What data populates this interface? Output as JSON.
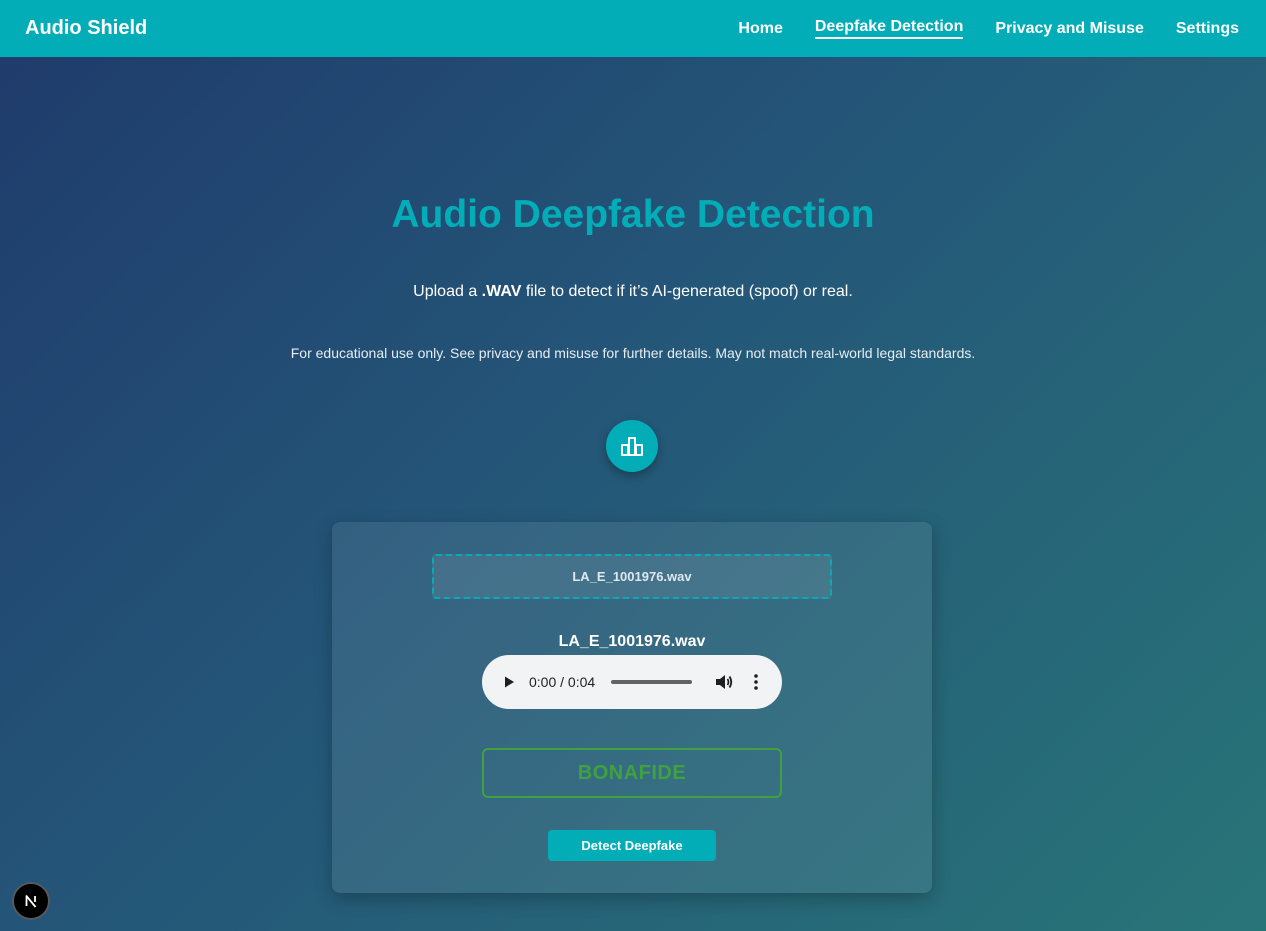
{
  "navbar": {
    "brand": "Audio Shield",
    "links": [
      {
        "label": "Home",
        "active": false
      },
      {
        "label": "Deepfake Detection",
        "active": true
      },
      {
        "label": "Privacy and Misuse",
        "active": false
      },
      {
        "label": "Settings",
        "active": false
      }
    ]
  },
  "hero": {
    "title": "Audio Deepfake Detection",
    "subtitle_before": "Upload a ",
    "subtitle_bold": ".WAV",
    "subtitle_after": " file to detect if it’s AI-generated (spoof) or real.",
    "disclaimer": "For educational use only. See privacy and misuse for further details. May not match real-world legal standards.",
    "badge_icon": "bar-chart-icon"
  },
  "upload": {
    "dropzone_label": "LA_E_1001976.wav",
    "file_name": "LA_E_1001976.wav"
  },
  "player": {
    "time": "0:00 / 0:04",
    "play_icon": "play-icon",
    "volume_icon": "volume-icon",
    "more_icon": "more-vertical-icon"
  },
  "result": {
    "label": "BONAFIDE",
    "color": "#3fa13f"
  },
  "actions": {
    "detect_label": "Detect Deepfake"
  },
  "dev_badge": {
    "letter": "N"
  },
  "colors": {
    "accent": "#03adb8",
    "bonafide": "#3fa13f"
  }
}
